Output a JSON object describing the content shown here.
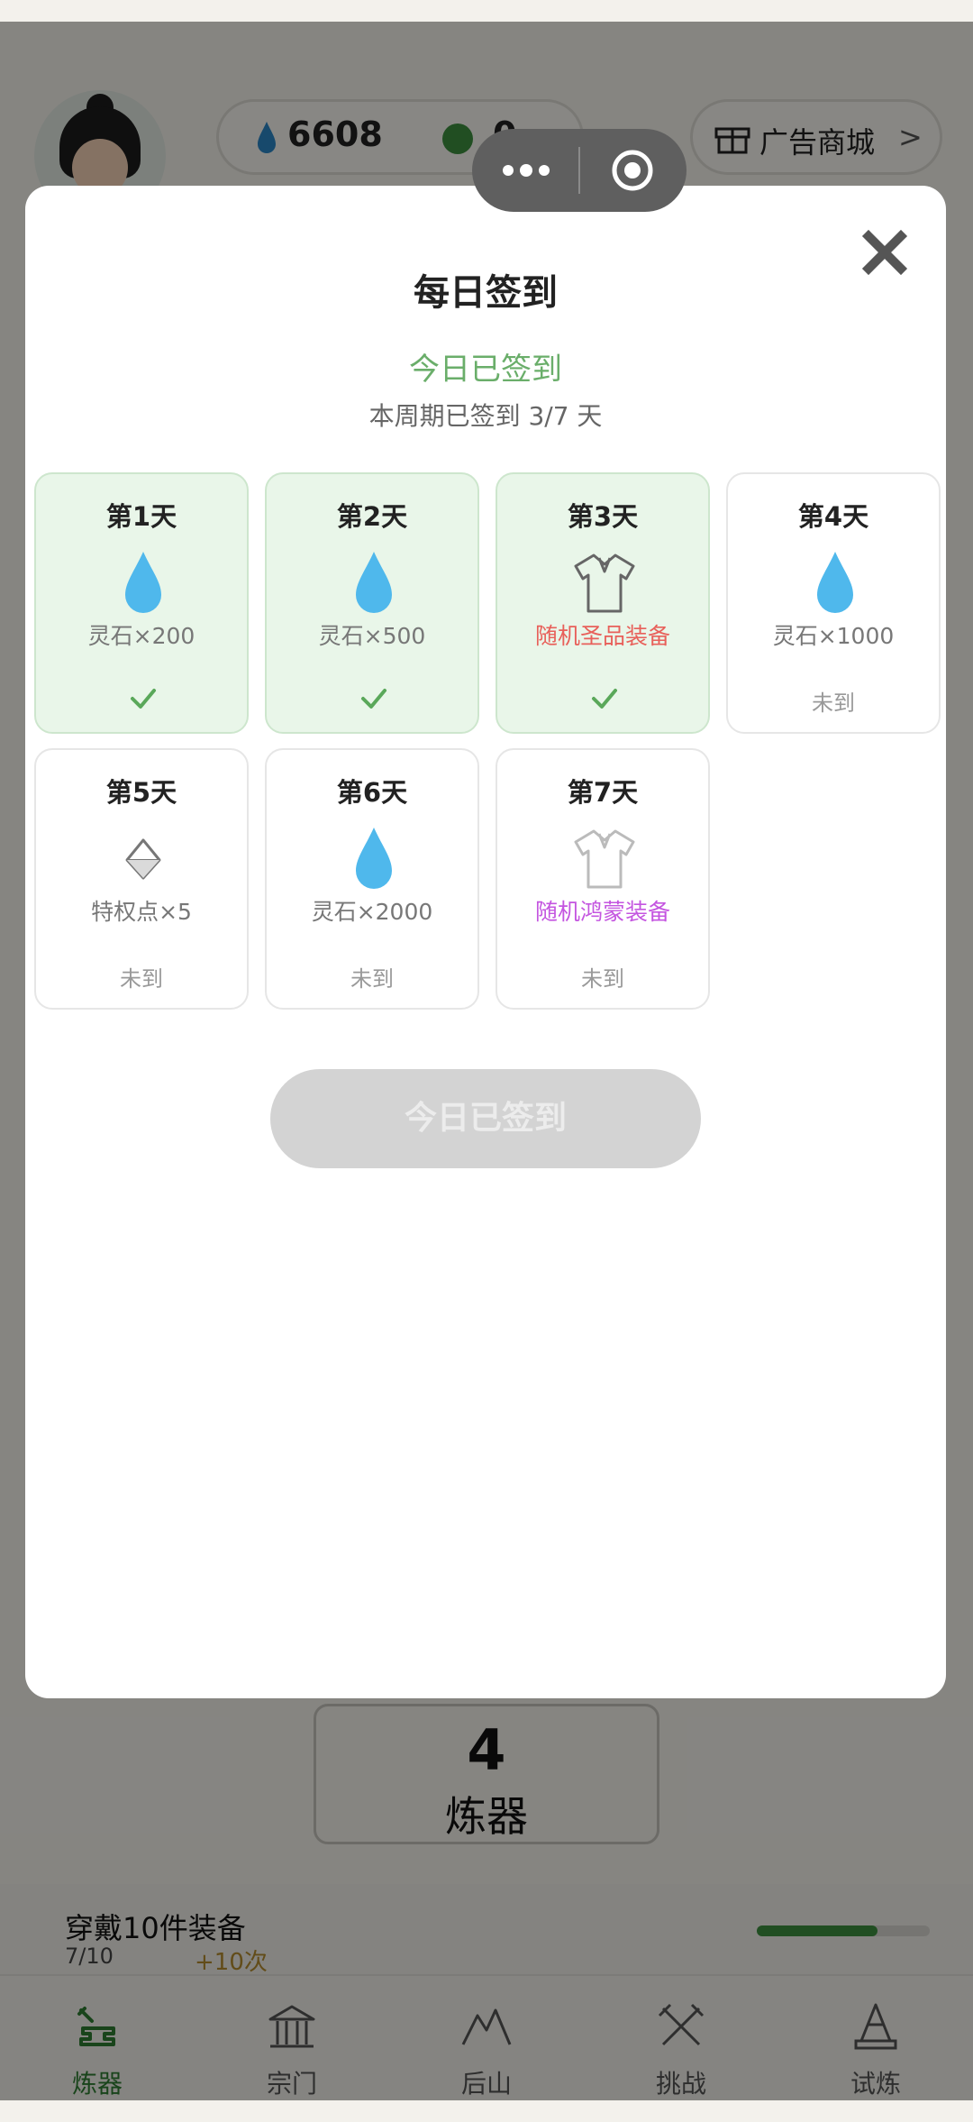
{
  "header": {
    "spirit_stones": "6608",
    "green_points": "0",
    "shop_label": "广告商城",
    "shop_chevron": ">"
  },
  "modal": {
    "title": "每日签到",
    "status": "今日已签到",
    "subtitle": "本周期已签到 3/7 天",
    "button_label": "今日已签到",
    "days": [
      {
        "name": "第1天",
        "reward": "灵石×200",
        "state": "claimed",
        "icon": "water-drop-icon"
      },
      {
        "name": "第2天",
        "reward": "灵石×500",
        "state": "claimed",
        "icon": "water-drop-icon"
      },
      {
        "name": "第3天",
        "reward": "随机圣品装备",
        "state": "claimed",
        "icon": "robe-icon"
      },
      {
        "name": "第4天",
        "reward": "灵石×1000",
        "state_label": "未到",
        "icon": "water-drop-icon"
      },
      {
        "name": "第5天",
        "reward": "特权点×5",
        "state_label": "未到",
        "icon": "diamond-icon"
      },
      {
        "name": "第6天",
        "reward": "灵石×2000",
        "state_label": "未到",
        "icon": "water-drop-icon"
      },
      {
        "name": "第7天",
        "reward": "随机鸿蒙装备",
        "state_label": "未到",
        "icon": "robe-icon"
      }
    ]
  },
  "forge": {
    "count": "4",
    "label": "炼器"
  },
  "task": {
    "title": "穿戴10件装备",
    "progress": "7/10",
    "progress_fraction": 0.7,
    "reward": "+10次"
  },
  "tabs": [
    {
      "label": "炼器",
      "icon": "anvil-icon",
      "active": true
    },
    {
      "label": "宗门",
      "icon": "temple-icon",
      "active": false
    },
    {
      "label": "后山",
      "icon": "mountain-icon",
      "active": false
    },
    {
      "label": "挑战",
      "icon": "crossed-swords-icon",
      "active": false
    },
    {
      "label": "试炼",
      "icon": "pagoda-icon",
      "active": false
    }
  ],
  "colors": {
    "accent_green": "#3d8f3f",
    "claimed_bg": "#e9f6e9",
    "drop_blue": "#4fb8ec",
    "red_reward": "#e8605a",
    "purple_reward": "#c455e0"
  }
}
